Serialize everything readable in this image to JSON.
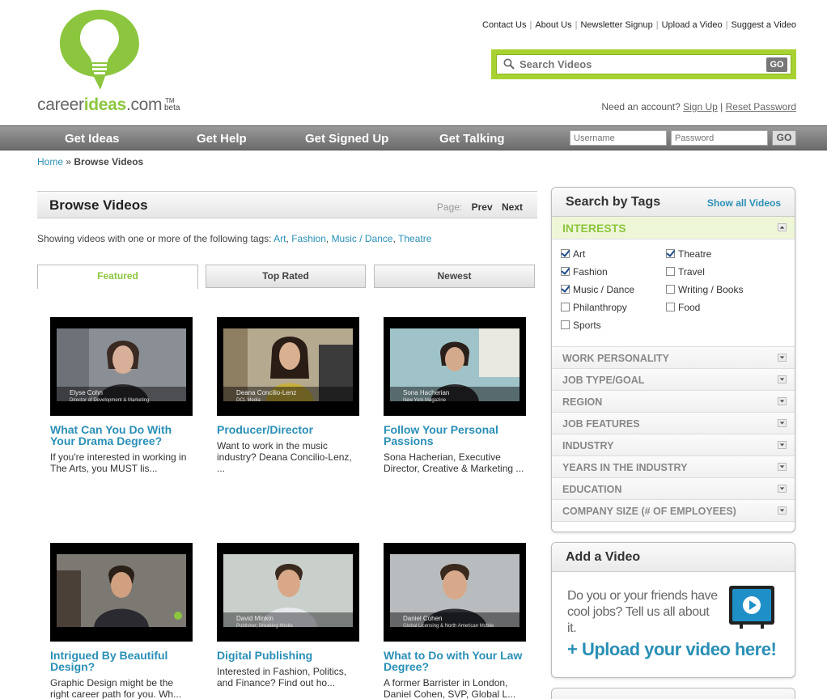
{
  "header": {
    "logo_word_1": "career",
    "logo_word_2": "ideas",
    "logo_word_3": ".com",
    "logo_tm": "TM",
    "logo_beta": "beta",
    "top_links": [
      "Contact Us",
      "About Us",
      "Newsletter Signup",
      "Upload a Video",
      "Suggest a Video"
    ],
    "search": {
      "placeholder": "Search Videos",
      "go_label": "GO"
    },
    "account_prompt": "Need an account?",
    "sign_up": "Sign Up",
    "account_sep": "|",
    "reset_password": "Reset Password"
  },
  "nav": {
    "items": [
      "Get Ideas",
      "Get Help",
      "Get Signed Up",
      "Get Talking"
    ],
    "username_placeholder": "Username",
    "password_placeholder": "Password",
    "go_label": "GO"
  },
  "breadcrumb": {
    "home": "Home",
    "sep": "»",
    "current": "Browse Videos"
  },
  "browse": {
    "title": "Browse Videos",
    "page_label": "Page:",
    "prev": "Prev",
    "next": "Next",
    "tags_intro": "Showing videos with one or more of the following tags:",
    "tags": [
      "Art",
      "Fashion",
      "Music / Dance",
      "Theatre"
    ],
    "tabs": [
      "Featured",
      "Top Rated",
      "Newest"
    ]
  },
  "videos": [
    {
      "title": "What Can You Do With Your Drama Degree?",
      "desc": "If you're interested in working in The Arts, you MUST lis...",
      "person": "Elyse Cohn",
      "role": "Director of Development & Marketing"
    },
    {
      "title": "Producer/Director",
      "desc": "Want to work in the music industry? Deana Concilio-Lenz, ...",
      "person": "Deana Concilio-Lenz",
      "role": "DCL Media"
    },
    {
      "title": "Follow Your Personal Passions",
      "desc": "Sona Hacherian, Executive Director, Creative & Marketing ...",
      "person": "Sona Hacherian",
      "role": "New York Magazine"
    },
    {
      "title": "Intrigued By Beautiful Design?",
      "desc": "Graphic Design might be the right career path for you. Wh...",
      "person": "",
      "role": ""
    },
    {
      "title": "Digital Publishing",
      "desc": "Interested in Fashion, Politics, and Finance? Find out ho...",
      "person": "David Minkin",
      "role": "Publisher, Breaking Media"
    },
    {
      "title": "What to Do with Your Law Degree?",
      "desc": "A former Barrister in London, Daniel Cohen, SVP, Global L...",
      "person": "Daniel Cohen",
      "role": "Global Licensing & North American Mobile"
    }
  ],
  "sidebar": {
    "title": "Search by Tags",
    "show_all": "Show all Videos",
    "interests_label": "INTERESTS",
    "interests": [
      {
        "label": "Art",
        "checked": true
      },
      {
        "label": "Theatre",
        "checked": true
      },
      {
        "label": "Fashion",
        "checked": true
      },
      {
        "label": "Travel",
        "checked": false
      },
      {
        "label": "Music / Dance",
        "checked": true
      },
      {
        "label": "Writing / Books",
        "checked": false
      },
      {
        "label": "Philanthropy",
        "checked": false
      },
      {
        "label": "Food",
        "checked": false
      },
      {
        "label": "Sports",
        "checked": false
      }
    ],
    "categories": [
      "WORK PERSONALITY",
      "JOB TYPE/GOAL",
      "REGION",
      "JOB FEATURES",
      "INDUSTRY",
      "YEARS IN THE INDUSTRY",
      "EDUCATION",
      "COMPANY SIZE (# OF EMPLOYEES)"
    ]
  },
  "add_video": {
    "title": "Add a Video",
    "text": "Do you or your friends have cool jobs? Tell us all about it.",
    "upload": "+ Upload your video here!"
  },
  "colors": {
    "brand_green": "#8cc63f",
    "link_blue": "#2a8fb6",
    "nav_gray": "#777777"
  }
}
